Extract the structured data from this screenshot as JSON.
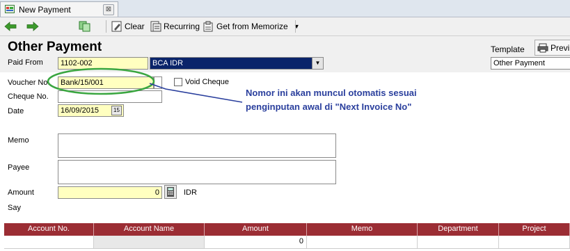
{
  "tab": {
    "title": "New Payment",
    "close": "⊠"
  },
  "toolbar": {
    "clear": "Clear",
    "recurring": "Recurring",
    "memorize": "Get from Memorize"
  },
  "form": {
    "title": "Other Payment",
    "paid_from_label": "Paid From",
    "paid_from_code": "1102-002",
    "paid_from_account": "BCA IDR",
    "template_label": "Template",
    "template_value": "Other Payment",
    "preview_label": "Previ",
    "voucher_label": "Voucher No.",
    "voucher_value": "Bank/15/001",
    "void_label": "Void Cheque",
    "cheque_label": "Cheque No.",
    "cheque_value": "",
    "date_label": "Date",
    "date_value": "16/09/2015",
    "memo_label": "Memo",
    "payee_label": "Payee",
    "amount_label": "Amount",
    "amount_value": "0",
    "currency": "IDR",
    "say_label": "Say"
  },
  "annotation": {
    "line1": "Nomor ini akan muncul otomatis sesuai",
    "line2": "penginputan awal di \"Next Invoice No\""
  },
  "grid": {
    "headers": [
      "Account No.",
      "Account Name",
      "Amount",
      "Memo",
      "Department",
      "Project"
    ],
    "row": [
      "",
      "",
      "0",
      "",
      "",
      ""
    ]
  },
  "colors": {
    "grid_header": "#9b2d34",
    "annotation": "#2a3f9d",
    "highlight_ellipse": "#3aa640",
    "field_yellow": "#ffffc0"
  }
}
